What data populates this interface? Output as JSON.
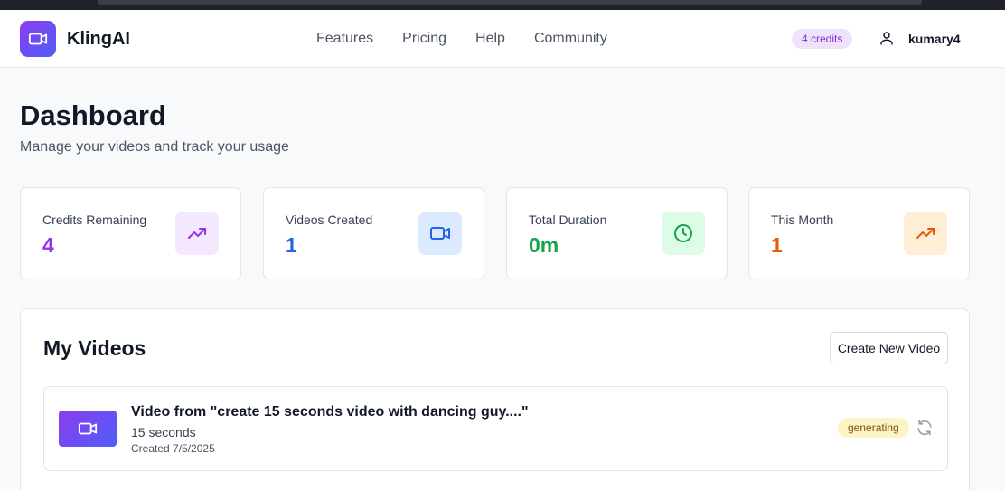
{
  "header": {
    "brand": "KlingAI",
    "nav": [
      "Features",
      "Pricing",
      "Help",
      "Community"
    ],
    "credits_badge": "4 credits",
    "username": "kumary4"
  },
  "page": {
    "title": "Dashboard",
    "subtitle": "Manage your videos and track your usage"
  },
  "stats": [
    {
      "label": "Credits Remaining",
      "value": "4",
      "color": "#9333ea",
      "icon_bg": "#f3e8ff",
      "icon": "trending-up-icon"
    },
    {
      "label": "Videos Created",
      "value": "1",
      "color": "#2563eb",
      "icon_bg": "#dbeafe",
      "icon": "video-camera-icon"
    },
    {
      "label": "Total Duration",
      "value": "0m",
      "color": "#16a34a",
      "icon_bg": "#dcfce7",
      "icon": "clock-icon"
    },
    {
      "label": "This Month",
      "value": "1",
      "color": "#ea580c",
      "icon_bg": "#ffedd5",
      "icon": "trending-up-icon"
    }
  ],
  "videos": {
    "title": "My Videos",
    "create_button": "Create New Video",
    "items": [
      {
        "title": "Video from \"create 15 seconds video with dancing guy....\"",
        "duration": "15 seconds",
        "created": "Created 7/5/2025",
        "status": "generating"
      }
    ]
  }
}
